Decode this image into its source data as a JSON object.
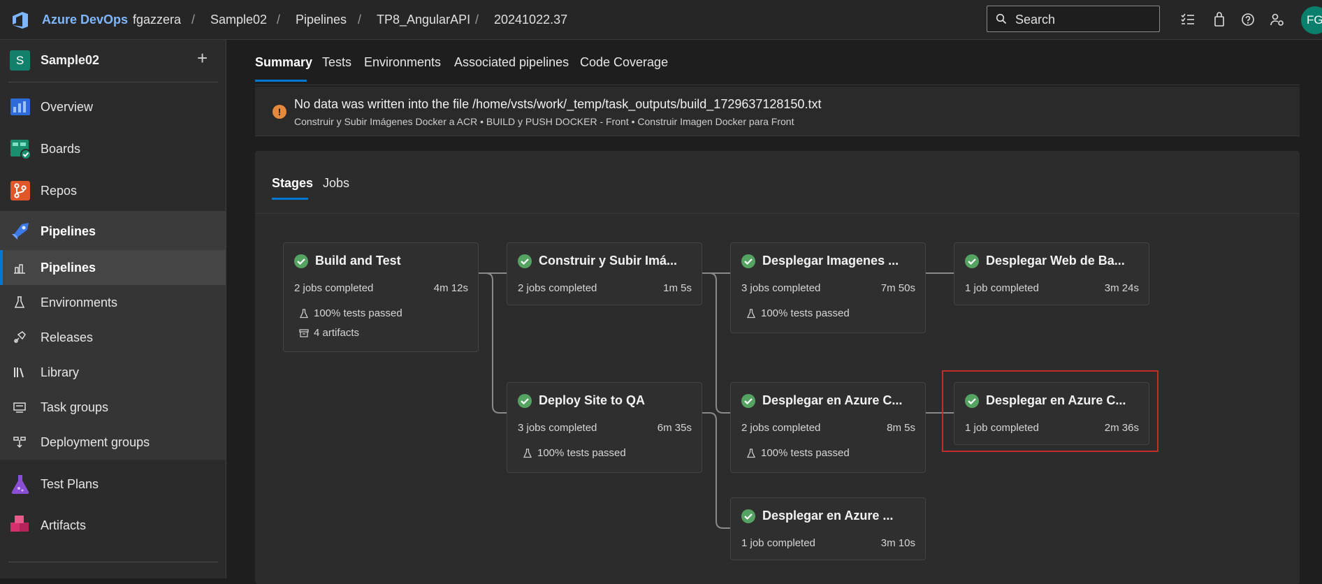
{
  "topbar": {
    "brand": "Azure DevOps",
    "breadcrumbs": [
      "fgazzera",
      "Sample02",
      "Pipelines",
      "TP8_AngularAPI",
      "20241022.37"
    ],
    "search_placeholder": "Search",
    "avatar_initials": "FG"
  },
  "sidebar": {
    "project_initial": "S",
    "project_name": "Sample02",
    "add_label": "+",
    "items": [
      {
        "label": "Overview"
      },
      {
        "label": "Boards"
      },
      {
        "label": "Repos"
      },
      {
        "label": "Pipelines"
      }
    ],
    "sub_items": [
      {
        "label": "Pipelines"
      },
      {
        "label": "Environments"
      },
      {
        "label": "Releases"
      },
      {
        "label": "Library"
      },
      {
        "label": "Task groups"
      },
      {
        "label": "Deployment groups"
      }
    ],
    "bottom_items": [
      {
        "label": "Test Plans"
      },
      {
        "label": "Artifacts"
      }
    ]
  },
  "tabs": [
    "Summary",
    "Tests",
    "Environments",
    "Associated pipelines",
    "Code Coverage"
  ],
  "warning": {
    "icon": "!",
    "title": "No data was written into the file /home/vsts/work/_temp/task_outputs/build_1729637128150.txt",
    "detail": "Construir y Subir Imágenes Docker a ACR • BUILD y PUSH DOCKER - Front • Construir Imagen Docker para Front"
  },
  "stage_tabs": [
    "Stages",
    "Jobs"
  ],
  "stages": [
    {
      "name": "Build and Test",
      "jobs": "2 jobs completed",
      "duration": "4m 12s",
      "tests": "100% tests passed",
      "artifacts": "4 artifacts",
      "status": "succeeded"
    },
    {
      "name": "Construir y Subir Imá...",
      "jobs": "2 jobs completed",
      "duration": "1m 5s",
      "status": "succeeded"
    },
    {
      "name": "Deploy Site to QA",
      "jobs": "3 jobs completed",
      "duration": "6m 35s",
      "tests": "100% tests passed",
      "status": "succeeded"
    },
    {
      "name": "Desplegar Imagenes ...",
      "jobs": "3 jobs completed",
      "duration": "7m 50s",
      "tests": "100% tests passed",
      "status": "succeeded"
    },
    {
      "name": "Desplegar en Azure C...",
      "jobs": "2 jobs completed",
      "duration": "8m 5s",
      "tests": "100% tests passed",
      "status": "succeeded"
    },
    {
      "name": "Desplegar en Azure ...",
      "jobs": "1 job completed",
      "duration": "3m 10s",
      "status": "succeeded"
    },
    {
      "name": "Desplegar Web de Ba...",
      "jobs": "1 job completed",
      "duration": "3m 24s",
      "status": "succeeded"
    },
    {
      "name": "Desplegar en Azure C...",
      "jobs": "1 job completed",
      "duration": "2m 36s",
      "status": "succeeded"
    }
  ],
  "colors": {
    "accent": "#0078d4",
    "success": "#55a362",
    "warning": "#e58a3c",
    "highlight": "#c62b2b"
  }
}
